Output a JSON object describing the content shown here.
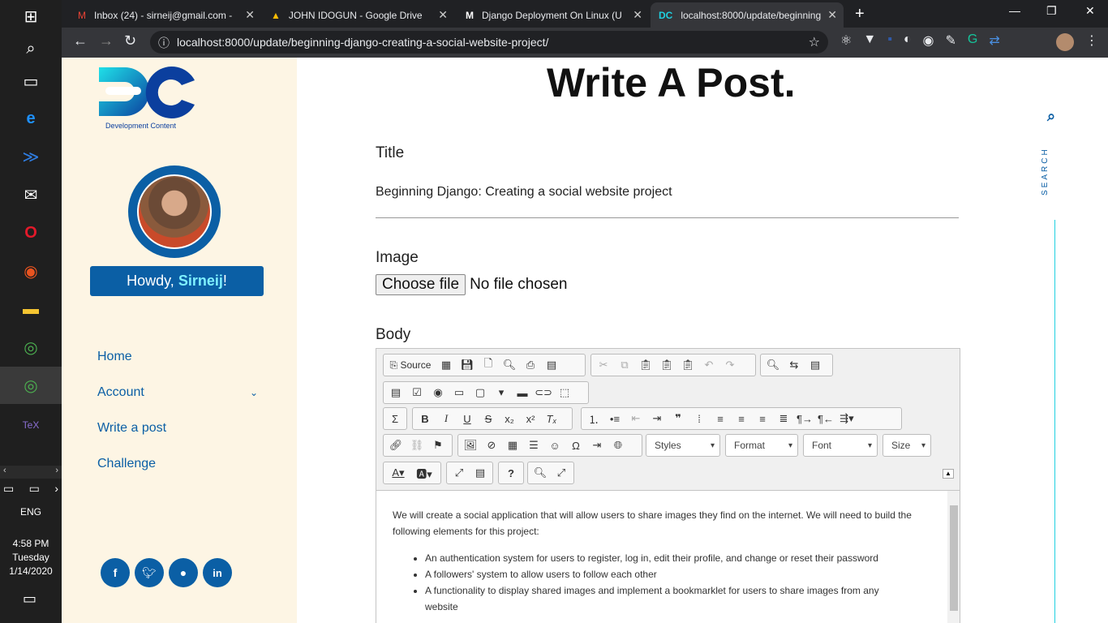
{
  "browser": {
    "tabs": [
      {
        "title": "Inbox (24) - sirneij@gmail.com -",
        "icon": "gmail-icon"
      },
      {
        "title": "JOHN IDOGUN - Google Drive",
        "icon": "drive-icon"
      },
      {
        "title": "Django Deployment On Linux (U",
        "icon": "medium-icon"
      },
      {
        "title": "localhost:8000/update/beginning",
        "icon": "dc-icon"
      }
    ],
    "url": "localhost:8000/update/beginning-django-creating-a-social-website-project/"
  },
  "taskbar": {
    "language": "ENG",
    "time": "4:58 PM",
    "day": "Tuesday",
    "date": "1/14/2020"
  },
  "sidebar": {
    "logo_text": "Development Content",
    "greeting_prefix": "Howdy, ",
    "username": "Sirneij",
    "greeting_suffix": "!",
    "nav": [
      {
        "label": "Home"
      },
      {
        "label": "Account"
      },
      {
        "label": "Write a post"
      },
      {
        "label": "Challenge"
      }
    ],
    "social": [
      "facebook-icon",
      "twitter-icon",
      "github-icon",
      "linkedin-icon"
    ]
  },
  "main": {
    "heading": "Write A Post.",
    "title_label": "Title",
    "title_value": "Beginning Django: Creating a social website project",
    "image_label": "Image",
    "choose_file": "Choose file",
    "no_file": "No file chosen",
    "body_label": "Body",
    "search_label": "SEARCH"
  },
  "editor": {
    "source_label": "Source",
    "combos": [
      "Styles",
      "Format",
      "Font",
      "Size"
    ],
    "paragraph": "We will create a social application that will allow users to share images they find on the internet. We will need to build the following elements for this project:",
    "list": [
      "An authentication system for users to register, log in, edit their profile, and change or reset their password",
      "A followers' system to allow users to follow each other",
      "A functionality to display shared images and implement a bookmarklet for users to share images from any website"
    ]
  },
  "colors": {
    "accent": "#0b5fa5",
    "sidebar_bg": "#fdf5e4",
    "greeting_bg": "#0b5fa5",
    "cyan": "#1fd0e0"
  }
}
